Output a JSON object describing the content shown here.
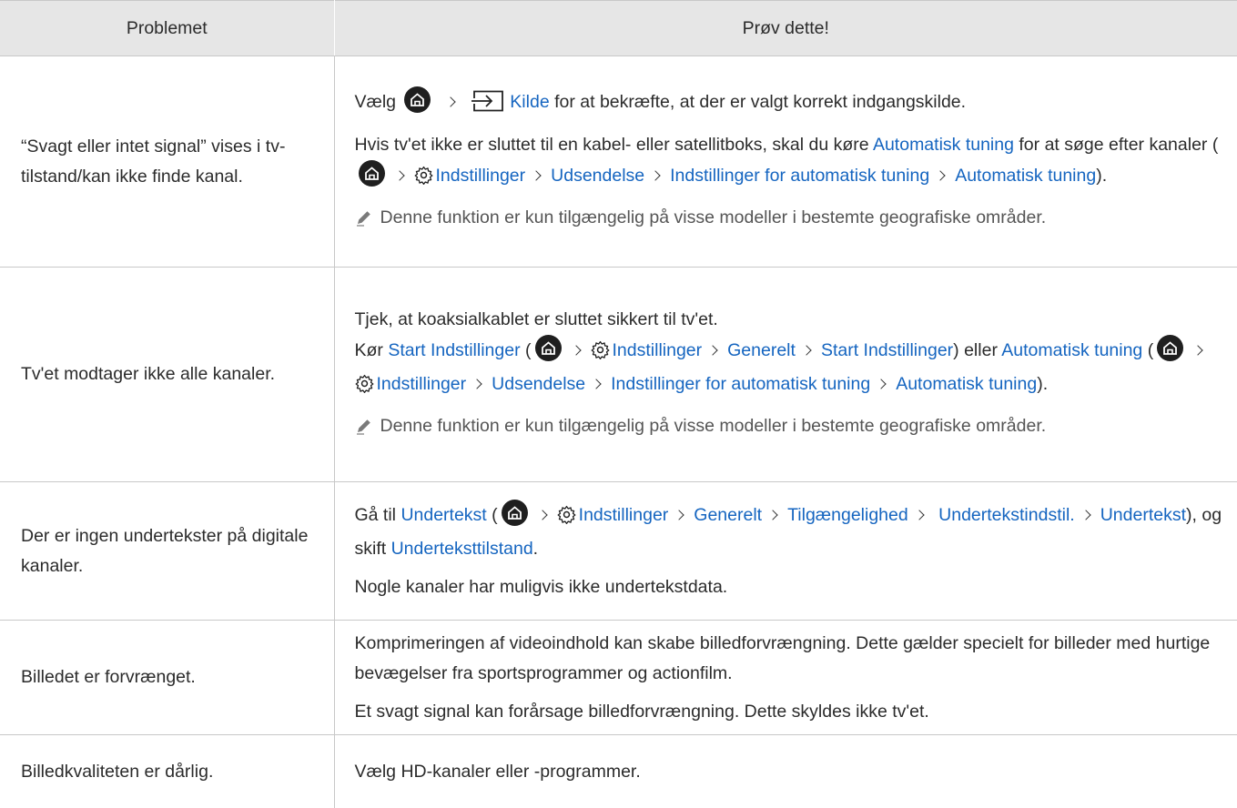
{
  "header": {
    "col_problem": "Problemet",
    "col_solution": "Prøv dette!"
  },
  "rows": [
    {
      "problem": "“Svagt eller intet signal” vises i tv-tilstand/kan ikke finde kanal.",
      "p1": {
        "t1": "Vælg",
        "kilde": "Kilde",
        "t2": "for at bekræfte, at der er valgt korrekt indgangskilde."
      },
      "p2": {
        "t1": "Hvis tv'et ikke er sluttet til en kabel- eller satellitboks, skal du køre",
        "auto": "Automatisk tuning",
        "t2": "for at søge efter kanaler (",
        "indst": "Indstillinger",
        "udsend": "Udsendelse",
        "indst_auto": "Indstillinger for automatisk tuning",
        "auto2": "Automatisk tuning",
        "t3": ")."
      },
      "note": "Denne funktion er kun tilgængelig på visse modeller i bestemte geografiske områder."
    },
    {
      "problem": "Tv'et modtager ikke alle kanaler.",
      "p1": "Tjek, at koaksialkablet er sluttet sikkert til tv'et.",
      "p2": {
        "t1": "Kør",
        "start": "Start Indstillinger",
        "open": "(",
        "indst": "Indstillinger",
        "gen": "Generelt",
        "start2": "Start Indstillinger",
        "t2": ") eller",
        "auto": "Automatisk tuning",
        "open2": "(",
        "indst2": "Indstillinger",
        "udsend": "Udsendelse",
        "indst_auto": "Indstillinger for automatisk tuning",
        "auto2": "Automatisk tuning",
        "t3": ")."
      },
      "note": "Denne funktion er kun tilgængelig på visse modeller i bestemte geografiske områder."
    },
    {
      "problem": "Der er ingen undertekster på digitale kanaler.",
      "p1": {
        "t1": "Gå til",
        "under": "Undertekst",
        "open": "(",
        "indst": "Indstillinger",
        "gen": "Generelt",
        "tilg": "Tilgængelighed",
        "understil": "Undertekstindstil.",
        "under2": "Undertekst",
        "t2": "), og skift",
        "undertilstand": "Underteksttilstand",
        "t3": "."
      },
      "p2": "Nogle kanaler har muligvis ikke undertekstdata."
    },
    {
      "problem": "Billedet er forvrænget.",
      "p1": "Komprimeringen af videoindhold kan skabe billedforvrængning. Dette gælder specielt for billeder med hurtige bevægelser fra sportsprogrammer og actionfilm.",
      "p2": "Et svagt signal kan forårsage billedforvrængning. Dette skyldes ikke tv'et."
    },
    {
      "problem": "Billedkvaliteten er dårlig.",
      "p1": "Vælg HD-kanaler eller -programmer."
    }
  ],
  "colors": {
    "link": "#1565c0",
    "header_bg": "#e6e6e6",
    "border": "#c8c8c8"
  },
  "icons": [
    "home-icon",
    "source-icon",
    "settings-gear-icon",
    "chevron-right-icon",
    "pencil-note-icon"
  ]
}
